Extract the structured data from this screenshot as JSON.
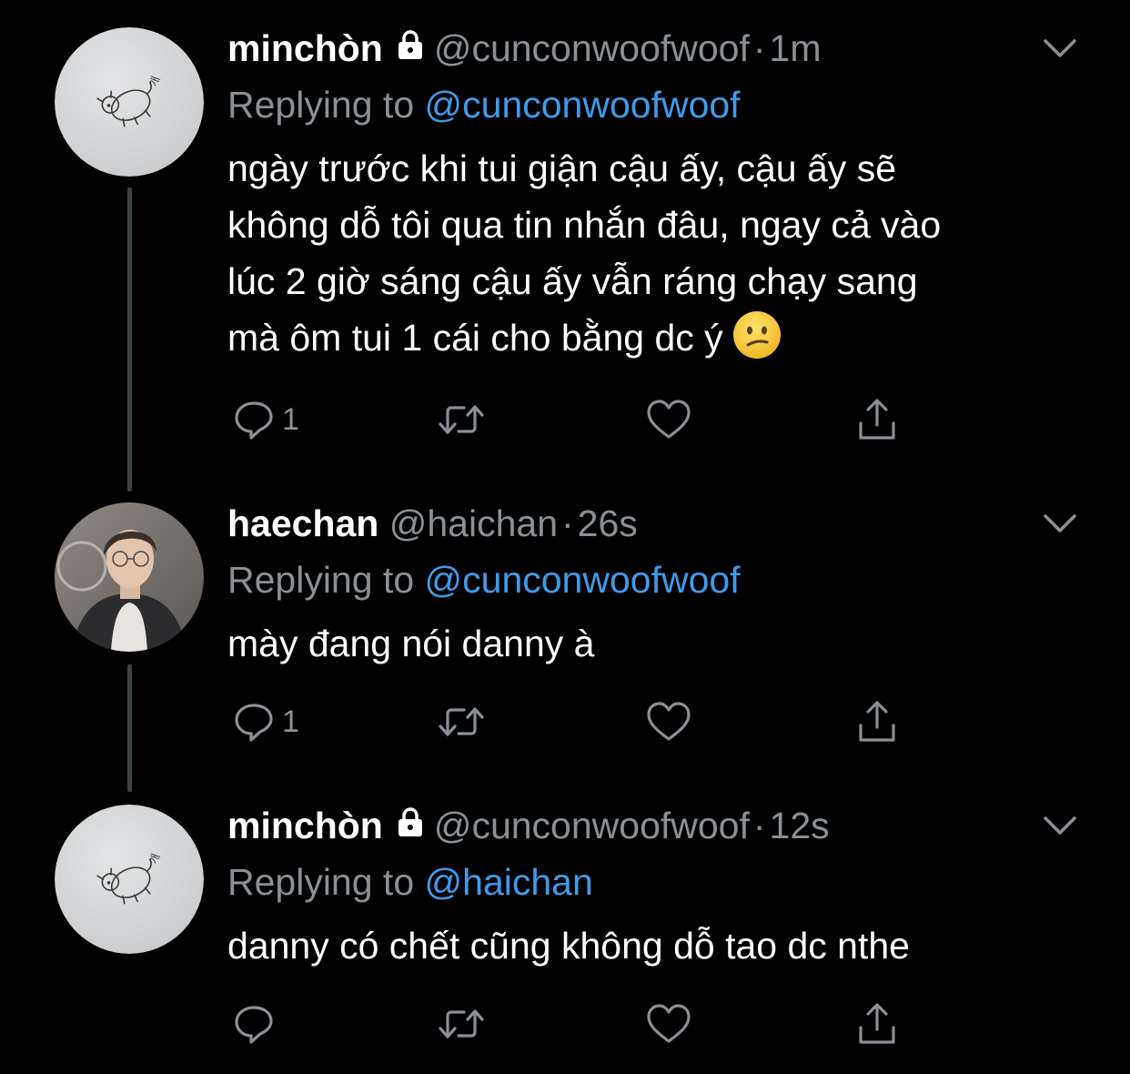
{
  "colors": {
    "background": "#000000",
    "link": "#3e9bea",
    "muted": "#8a9096",
    "thread_line": "#3d4247"
  },
  "tweets": [
    {
      "name": "minchòn",
      "locked": true,
      "handle": "@cunconwoofwoof",
      "time": "1m",
      "replying_prefix": "Replying to",
      "replying_to": "@cunconwoofwoof",
      "text": "ngày trước khi tui giận cậu ấy, cậu ấy sẽ\nkhông dỗ tôi qua tin nhắn đâu, ngay cả vào\nlúc 2 giờ sáng cậu ấy vẫn ráng chạy sang\nmà ôm tui 1 cái cho bằng dc ý",
      "emoji": "confused-face",
      "reply_count": "1",
      "avatar": "doodle-dog-avatar"
    },
    {
      "name": "haechan",
      "locked": false,
      "handle": "@haichan",
      "time": "26s",
      "replying_prefix": "Replying to",
      "replying_to": "@cunconwoofwoof",
      "text": "mày đang nói danny à",
      "reply_count": "1",
      "avatar": "person-photo-avatar"
    },
    {
      "name": "minchòn",
      "locked": true,
      "handle": "@cunconwoofwoof",
      "time": "12s",
      "replying_prefix": "Replying to",
      "replying_to": "@haichan",
      "text": "danny có chết cũng không dỗ tao dc nthe",
      "reply_count": "",
      "avatar": "doodle-dog-avatar"
    }
  ],
  "separator": "·"
}
